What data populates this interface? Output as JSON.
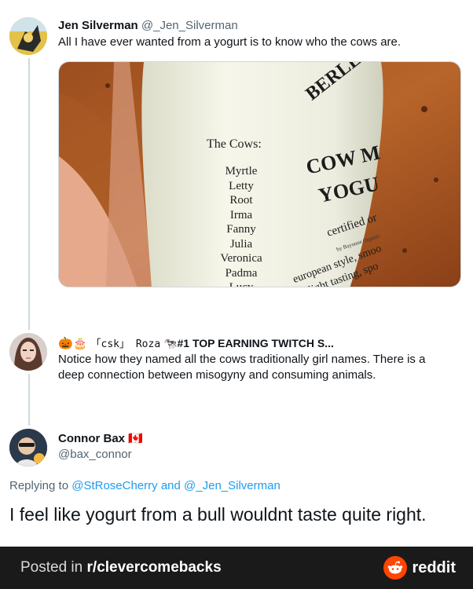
{
  "tweets": [
    {
      "name": "Jen Silverman",
      "handle": "@_Jen_Silverman",
      "text": "All I have ever wanted from a yogurt is to know who the cows are."
    },
    {
      "name_prefix": "🎃🎂",
      "name": "「csk」 Roza",
      "name_suffix": "🐄#1 TOP EARNING TWITCH S...",
      "text_line1": "Notice how they named all the cows traditionally girl names. There is a",
      "text_line2": "deep connection between misogyny and consuming animals."
    },
    {
      "name": "Connor Bax",
      "flag": "🇨🇦",
      "handle": "@bax_connor",
      "replying_prefix": "Replying to",
      "mention1": "@StRoseCherry",
      "replying_and": "and",
      "mention2": "@_Jen_Silverman",
      "text": "I feel like yogurt from a bull wouldnt taste quite right."
    }
  ],
  "photo": {
    "heading": "The Cows:",
    "cows": [
      "Myrtle",
      "Letty",
      "Root",
      "Irma",
      "Fanny",
      "Julia",
      "Veronica",
      "Padma",
      "Lucy"
    ],
    "brand": "BERLEY",
    "product_line1": "COW M",
    "product_line2": "YOGU",
    "certified": "certified or",
    "small_text": "by Bayonne Organic",
    "style_line1": "european style, smoo",
    "style_line2": "light tasting, spo"
  },
  "footer": {
    "posted_in": "Posted in",
    "subreddit": "r/clevercomebacks",
    "brand": "reddit"
  },
  "colors": {
    "link": "#1d9bf0",
    "footer_bg": "#1a1a1b",
    "reddit_orange": "#ff4500"
  }
}
